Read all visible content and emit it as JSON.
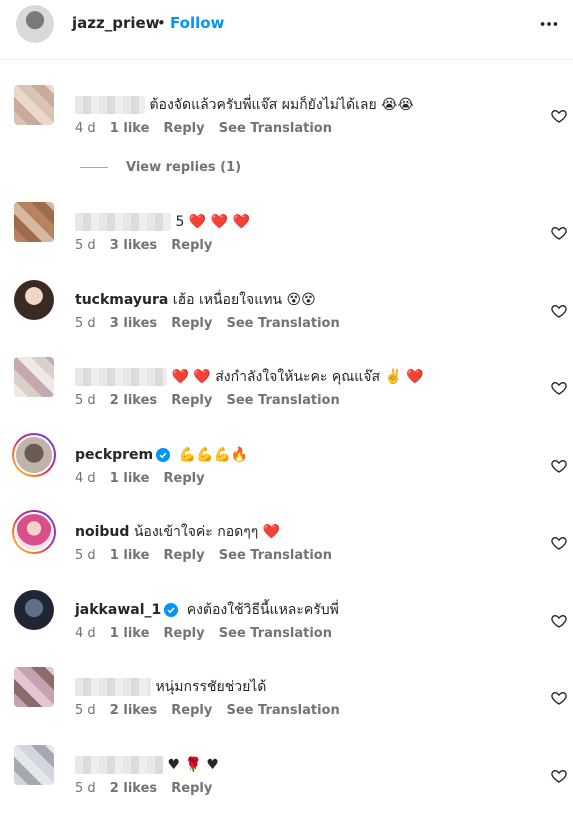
{
  "header": {
    "username": "jazz_priew",
    "separator": "•",
    "follow_label": "Follow"
  },
  "comments": [
    {
      "username": "",
      "username_redacted": true,
      "text": "ต้องจัดแล้วครับพี่แจ๊ส ผมก็ยังไม่ได้เลย 😭😭",
      "time": "4 d",
      "likes": "1 like",
      "reply": "Reply",
      "translate": "See Translation"
    },
    {
      "username": "",
      "username_redacted": true,
      "text": "5 ❤️ ❤️ ❤️",
      "time": "5 d",
      "likes": "3 likes",
      "reply": "Reply",
      "translate": ""
    },
    {
      "username": "tuckmayura",
      "text": "เฮ้อ เหนื่อยใจแทน 😵😵",
      "time": "5 d",
      "likes": "3 likes",
      "reply": "Reply",
      "translate": "See Translation"
    },
    {
      "username": "",
      "username_redacted": true,
      "text": "❤️ ❤️ ส่งกำลังใจให้นะคะ คุณแจ๊ส ✌️ ❤️",
      "time": "5 d",
      "likes": "2 likes",
      "reply": "Reply",
      "translate": "See Translation"
    },
    {
      "username": "peckprem",
      "verified": true,
      "text": "💪💪💪🔥",
      "time": "4 d",
      "likes": "1 like",
      "reply": "Reply",
      "translate": ""
    },
    {
      "username": "noibud",
      "text": "น้องเข้าใจค่ะ กอดๆๆ ❤️",
      "time": "5 d",
      "likes": "1 like",
      "reply": "Reply",
      "translate": "See Translation"
    },
    {
      "username": "jakkawal_1",
      "verified": true,
      "text": "คงต้องใช้วิธีนี้แหละครับพี่",
      "time": "4 d",
      "likes": "1 like",
      "reply": "Reply",
      "translate": "See Translation"
    },
    {
      "username": "",
      "username_redacted": true,
      "text": "หนุ่มกรรชัยช่วยได้",
      "time": "5 d",
      "likes": "2 likes",
      "reply": "Reply",
      "translate": "See Translation"
    },
    {
      "username": "",
      "username_redacted": true,
      "text": "♥ 🌹 ♥",
      "time": "5 d",
      "likes": "2 likes",
      "reply": "Reply",
      "translate": ""
    }
  ],
  "view_replies": "View replies (1)",
  "icons": {
    "more": "more-horizontal-icon",
    "like": "heart-outline-icon",
    "verified": "verified-badge-icon"
  },
  "colors": {
    "accent": "#0095f6",
    "text": "#262626",
    "meta": "#737373"
  }
}
